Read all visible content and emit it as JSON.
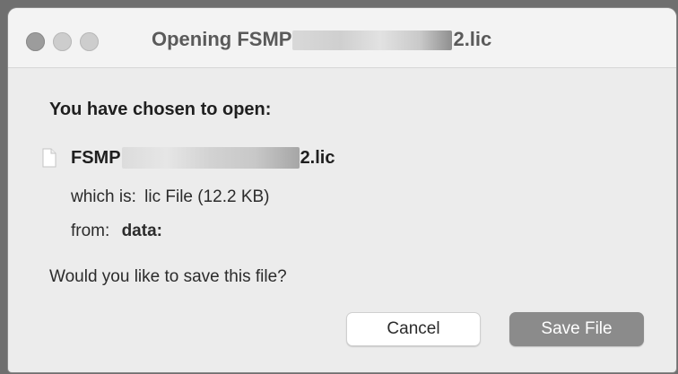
{
  "window": {
    "title_prefix": "Opening FSMP",
    "title_suffix": "2.lic"
  },
  "dialog": {
    "heading": "You have chosen to open:",
    "file": {
      "icon": "document-icon",
      "name_prefix": "FSMP",
      "name_suffix": "2.lic"
    },
    "type_label": "which is:",
    "type_value": "lic File (12.2 KB)",
    "from_label": "from:",
    "from_value": "data:",
    "question": "Would you like to save this file?"
  },
  "buttons": {
    "cancel_label": "Cancel",
    "save_label": "Save File"
  }
}
